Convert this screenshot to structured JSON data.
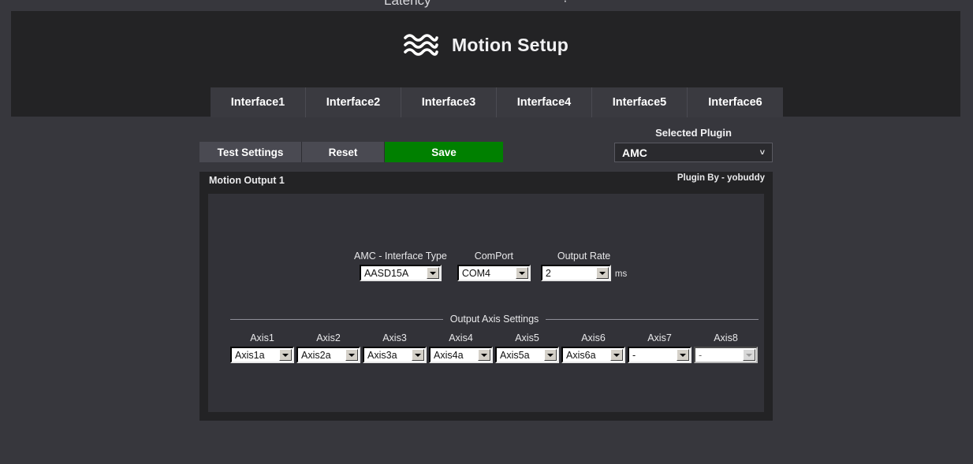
{
  "clipped_top": {
    "left_text": "Latency",
    "right_text": "·"
  },
  "header": {
    "logo_icon": "wave-lines-icon",
    "title": "Motion Setup",
    "tabs": [
      {
        "label": "Interface1"
      },
      {
        "label": "Interface2"
      },
      {
        "label": "Interface3"
      },
      {
        "label": "Interface4"
      },
      {
        "label": "Interface5"
      },
      {
        "label": "Interface6"
      }
    ]
  },
  "toolbar": {
    "test_settings_label": "Test Settings",
    "reset_label": "Reset",
    "save_label": "Save",
    "save_color": "#008000"
  },
  "selected_plugin": {
    "label": "Selected Plugin",
    "value": "AMC",
    "chevron": "˅"
  },
  "panel": {
    "title": "Motion Output 1",
    "credit": "Plugin By - yobuddy",
    "fields": [
      {
        "label": "AMC - Interface Type",
        "value": "AASD15A",
        "width_class": "w-iface",
        "name": "interface-type"
      },
      {
        "label": "ComPort",
        "value": "COM4",
        "width_class": "w-com",
        "name": "comport"
      },
      {
        "label": "Output Rate",
        "value": "2",
        "width_class": "w-rate",
        "name": "output-rate"
      }
    ],
    "output_rate_unit": "ms",
    "axis_settings": {
      "legend": "Output Axis Settings",
      "axes": [
        {
          "label": "Axis1",
          "value": "Axis1a",
          "disabled": false
        },
        {
          "label": "Axis2",
          "value": "Axis2a",
          "disabled": false
        },
        {
          "label": "Axis3",
          "value": "Axis3a",
          "disabled": false
        },
        {
          "label": "Axis4",
          "value": "Axis4a",
          "disabled": false
        },
        {
          "label": "Axis5",
          "value": "Axis5a",
          "disabled": false
        },
        {
          "label": "Axis6",
          "value": "Axis6a",
          "disabled": false
        },
        {
          "label": "Axis7",
          "value": "-",
          "disabled": false
        },
        {
          "label": "Axis8",
          "value": "-",
          "disabled": true
        }
      ]
    }
  }
}
